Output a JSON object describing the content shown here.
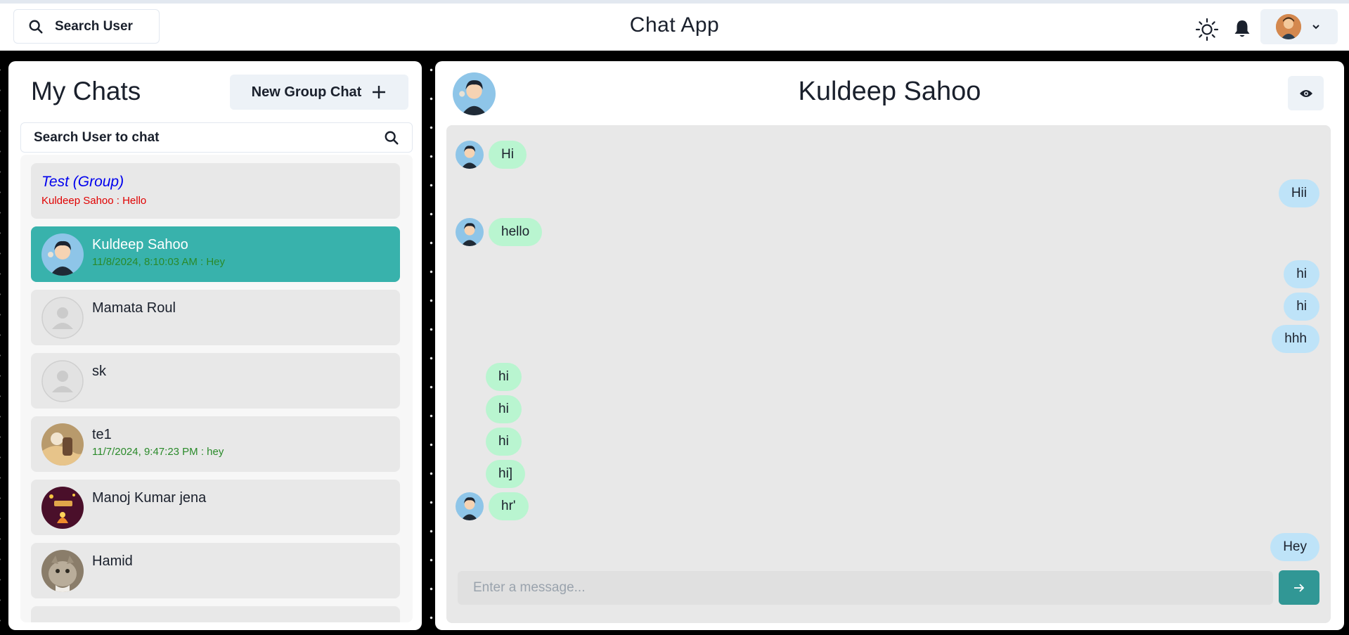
{
  "header": {
    "search_label": "Search User",
    "app_title": "Chat App"
  },
  "sidebar": {
    "title": "My Chats",
    "new_group_label": "New Group Chat",
    "search_placeholder": "Search User to chat",
    "chats": [
      {
        "name": "Test (Group)",
        "last": "Kuldeep Sahoo : Hello",
        "type": "group",
        "active": false
      },
      {
        "name": "Kuldeep Sahoo",
        "last": "11/8/2024, 8:10:03 AM : Hey",
        "type": "user",
        "active": true
      },
      {
        "name": "Mamata Roul",
        "last": "",
        "type": "user",
        "active": false
      },
      {
        "name": "sk",
        "last": "",
        "type": "user",
        "active": false
      },
      {
        "name": "te1",
        "last": "11/7/2024, 9:47:23 PM : hey",
        "type": "user",
        "active": false
      },
      {
        "name": "Manoj Kumar jena",
        "last": "",
        "type": "user",
        "active": false
      },
      {
        "name": "Hamid",
        "last": "",
        "type": "user",
        "active": false
      }
    ]
  },
  "conversation": {
    "contact_name": "Kuldeep Sahoo",
    "composer_placeholder": "Enter a message...",
    "messages": [
      {
        "text": "Hi",
        "dir": "in",
        "avatar": true
      },
      {
        "text": "Hii",
        "dir": "out"
      },
      {
        "text": "hello",
        "dir": "in",
        "avatar": true
      },
      {
        "text": "hi",
        "dir": "out"
      },
      {
        "text": "hi",
        "dir": "out"
      },
      {
        "text": "hhh",
        "dir": "out"
      },
      {
        "text": "hi",
        "dir": "in",
        "avatar": false
      },
      {
        "text": "hi",
        "dir": "in",
        "avatar": false
      },
      {
        "text": "hi",
        "dir": "in",
        "avatar": false
      },
      {
        "text": "hi]",
        "dir": "in",
        "avatar": false
      },
      {
        "text": "hr'",
        "dir": "in",
        "avatar": true
      },
      {
        "text": "Hey",
        "dir": "out"
      }
    ]
  },
  "colors": {
    "active_chat": "#38b2ac",
    "incoming_bubble": "#b9f5d0",
    "outgoing_bubble": "#bee3f8",
    "send_button": "#319795",
    "group_name": "#0000ee",
    "group_last": "#e00000",
    "last_message": "#2a8a2a"
  },
  "icons": {
    "search": "search-icon",
    "theme": "sun-icon",
    "notifications": "bell-icon",
    "dropdown": "chevron-down-icon",
    "new_group": "plus-icon",
    "view_profile": "eye-icon",
    "send": "arrow-right-icon"
  }
}
